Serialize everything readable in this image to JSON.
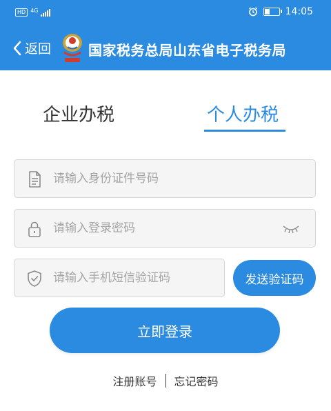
{
  "status_bar": {
    "hd": "HD",
    "network": "4G",
    "time": "14:05",
    "battery_level": 0.4
  },
  "nav": {
    "back_label": "返回",
    "title": "国家税务总局山东省电子税务局"
  },
  "tabs": [
    {
      "label": "企业办税",
      "active": false
    },
    {
      "label": "个人办税",
      "active": true
    }
  ],
  "form": {
    "id_placeholder": "请输入身份证件号码",
    "password_placeholder": "请输入登录密码",
    "sms_placeholder": "请输入手机短信验证码",
    "send_code_label": "发送验证码",
    "login_label": "立即登录"
  },
  "links": {
    "register": "注册账号",
    "forgot": "忘记密码"
  },
  "colors": {
    "primary": "#2a8be0",
    "field_bg": "#f5f5f5",
    "field_border": "#d6d6d6",
    "placeholder": "#a5a5a5",
    "text": "#333333"
  },
  "icons": [
    "back-chevron-icon",
    "tax-emblem-icon",
    "document-icon",
    "lock-icon",
    "eye-closed-icon",
    "shield-icon",
    "alarm-icon",
    "battery-icon",
    "signal-icon"
  ]
}
